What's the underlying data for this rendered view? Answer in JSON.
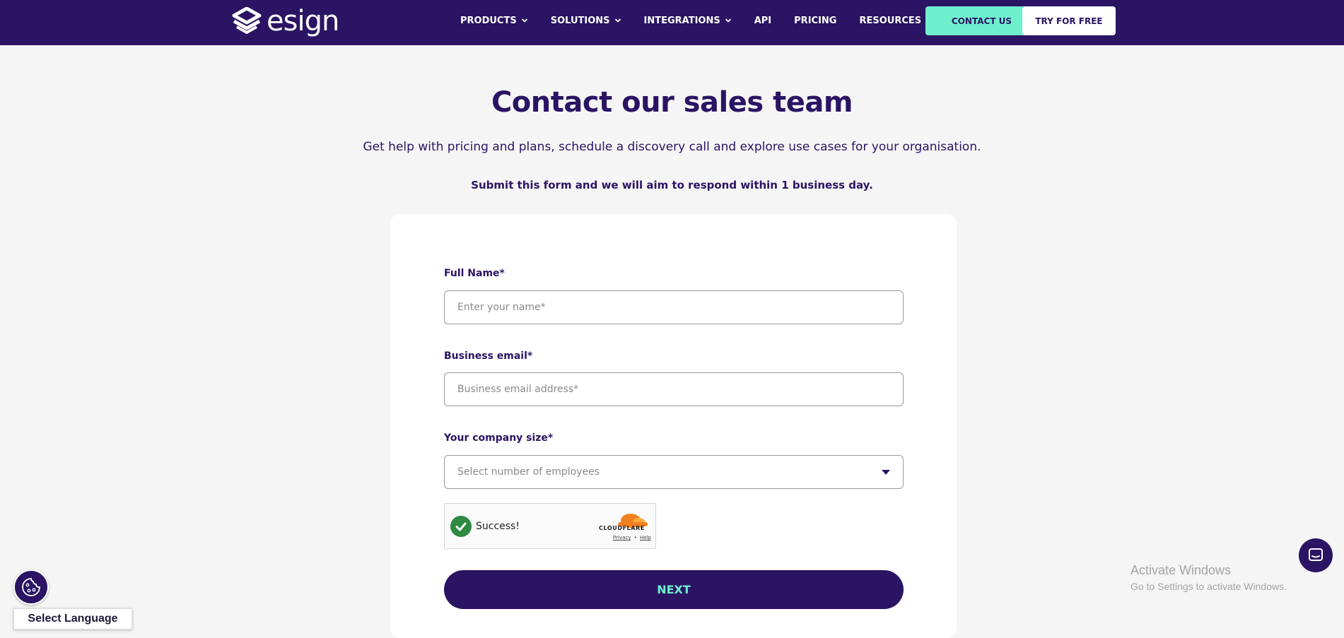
{
  "nav": {
    "logo_text": "esign",
    "items": [
      {
        "label": "PRODUCTS",
        "has_dropdown": true
      },
      {
        "label": "SOLUTIONS",
        "has_dropdown": true
      },
      {
        "label": "INTEGRATIONS",
        "has_dropdown": true
      },
      {
        "label": "API",
        "has_dropdown": false
      },
      {
        "label": "PRICING",
        "has_dropdown": false
      },
      {
        "label": "RESOURCES",
        "has_dropdown": true
      }
    ],
    "contact_label": "CONTACT US",
    "try_label": "TRY FOR FREE"
  },
  "hero": {
    "title": "Contact our sales team",
    "subtitle": "Get help with pricing and plans, schedule a discovery call and explore use cases for your organisation.",
    "notice": "Submit this form and we will aim to respond within 1 business day."
  },
  "form": {
    "full_name": {
      "label": "Full Name*",
      "placeholder": "Enter your name*",
      "value": ""
    },
    "email": {
      "label": "Business email*",
      "placeholder": "Business email address*",
      "value": ""
    },
    "company_size": {
      "label": "Your company size*",
      "selected": "Select number of employees"
    },
    "captcha": {
      "status": "Success!",
      "brand": "CLOUDFLARE",
      "privacy_link": "Privacy",
      "separator": "•",
      "help_link": "Help"
    },
    "next_label": "NEXT"
  },
  "floating": {
    "language_label": "Select Language",
    "cookie_icon": "cookie-icon",
    "chat_icon": "chat-icon"
  },
  "os_watermark": {
    "title": "Activate Windows",
    "subtitle": "Go to Settings to activate Windows."
  },
  "colors": {
    "brand": "#2a1463",
    "accent": "#6ef0cc",
    "background": "#f5f5f5",
    "success": "#2f8a42"
  }
}
